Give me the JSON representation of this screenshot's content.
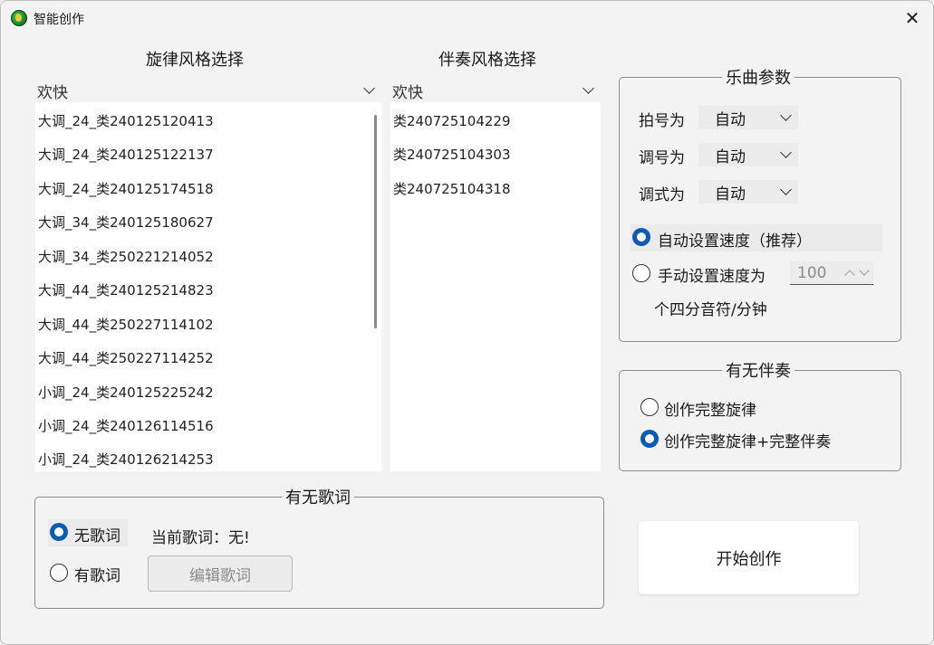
{
  "window": {
    "title": "智能创作"
  },
  "melody": {
    "heading": "旋律风格选择",
    "selected": "欢快",
    "items": [
      "大调_24_类240125120413",
      "大调_24_类240125122137",
      "大调_24_类240125174518",
      "大调_34_类240125180627",
      "大调_34_类250221214052",
      "大调_44_类240125214823",
      "大调_44_类250227114102",
      "大调_44_类250227114252",
      "小调_24_类240125225242",
      "小调_24_类240126114516",
      "小调_24_类240126214253"
    ]
  },
  "accomp": {
    "heading": "伴奏风格选择",
    "selected": "欢快",
    "items": [
      "类240725104229",
      "类240725104303",
      "类240725104318"
    ]
  },
  "params": {
    "title": "乐曲参数",
    "beat_label": "拍号为",
    "beat_value": "自动",
    "key_label": "调号为",
    "key_value": "自动",
    "mode_label": "调式为",
    "mode_value": "自动",
    "auto_speed_label": "自动设置速度（推荐）",
    "manual_speed_label": "手动设置速度为",
    "speed_value": "100",
    "speed_unit": "个四分音符/分钟",
    "auto_speed_checked": true
  },
  "accompaniment_option": {
    "title": "有无伴奏",
    "opt1": "创作完整旋律",
    "opt2": "创作完整旋律+完整伴奏",
    "selected": 2
  },
  "lyrics": {
    "title": "有无歌词",
    "no_lyrics": "无歌词",
    "has_lyrics": "有歌词",
    "current": "当前歌词：无!",
    "edit_button": "编辑歌词",
    "selected": "no_lyrics"
  },
  "start_button": "开始创作",
  "colors": {
    "accent": "#0a5bb5",
    "window_bg": "#f3f3f3"
  }
}
